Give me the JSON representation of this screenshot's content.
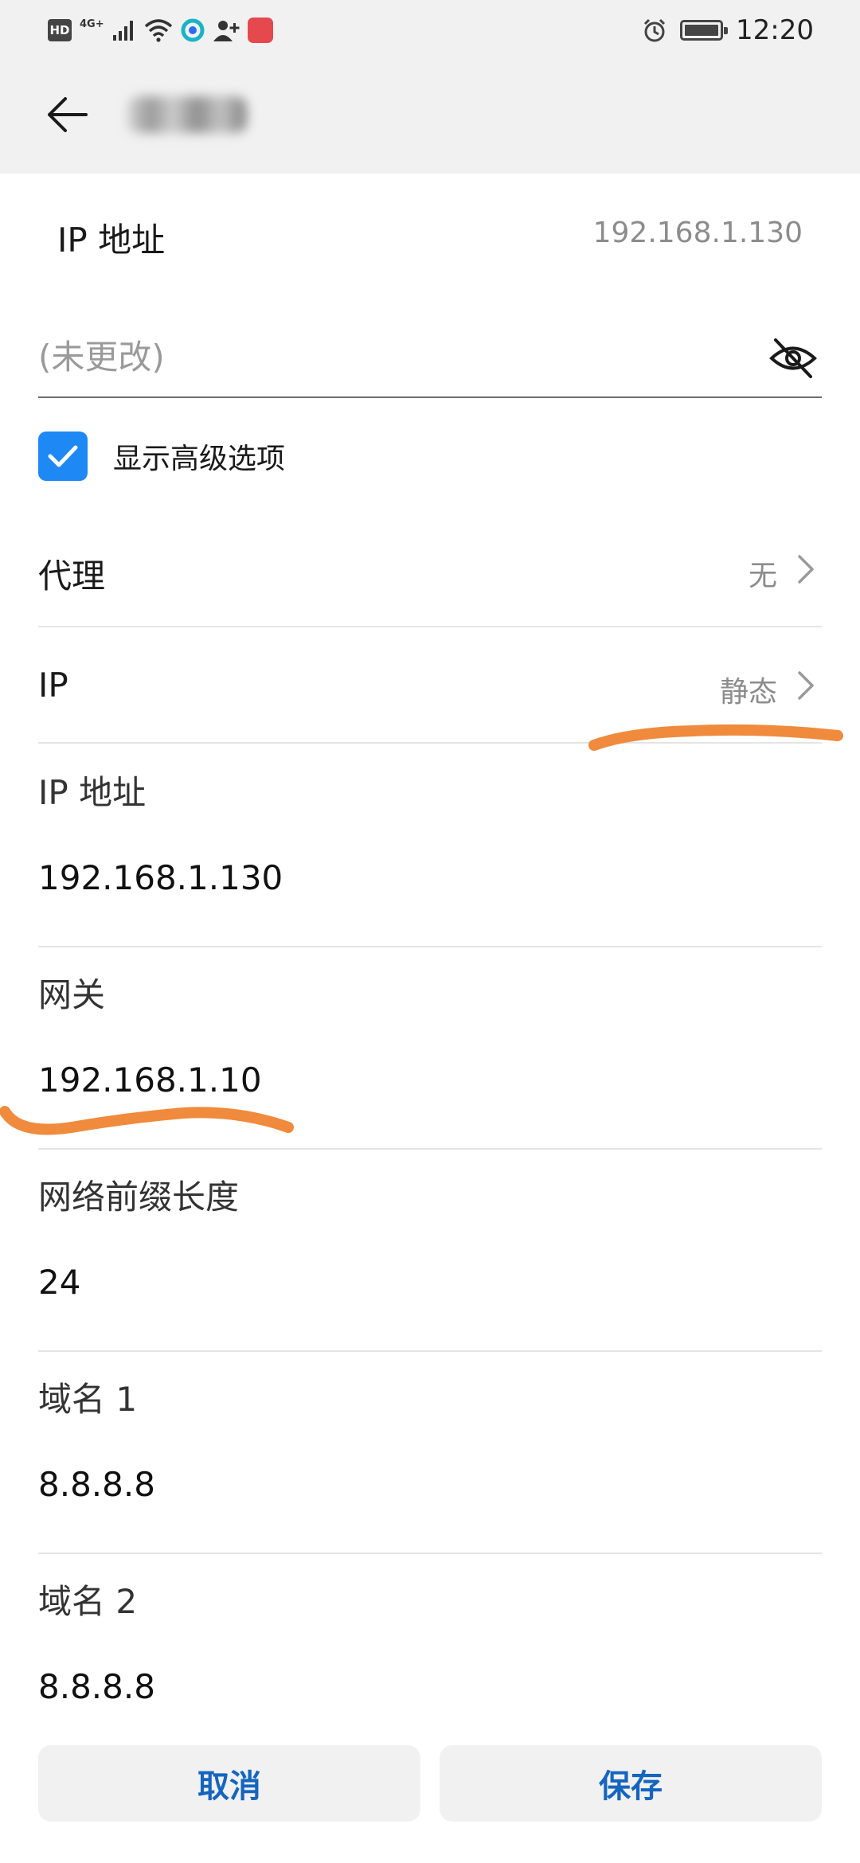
{
  "status_bar": {
    "hd": "HD",
    "network": "4G+",
    "time": "12:20"
  },
  "header": {
    "back_icon": "arrow-left-icon"
  },
  "ip_summary": {
    "label": "IP 地址",
    "value": "192.168.1.130"
  },
  "password": {
    "placeholder": "(未更改)",
    "visibility_icon": "eye-off-icon"
  },
  "advanced": {
    "label": "显示高级选项",
    "checked": true
  },
  "proxy": {
    "label": "代理",
    "value": "无"
  },
  "ip_mode": {
    "label": "IP",
    "value": "静态"
  },
  "fields": [
    {
      "label": "IP 地址",
      "value": "192.168.1.130"
    },
    {
      "label": "网关",
      "value": "192.168.1.10"
    },
    {
      "label": "网络前缀长度",
      "value": "24"
    },
    {
      "label": "域名 1",
      "value": "8.8.8.8"
    },
    {
      "label": "域名 2",
      "value": "8.8.8.8"
    }
  ],
  "buttons": {
    "cancel": "取消",
    "save": "保存"
  },
  "colors": {
    "accent": "#1e88f5",
    "button_text": "#1565c0",
    "annotation": "#f08a3c"
  }
}
